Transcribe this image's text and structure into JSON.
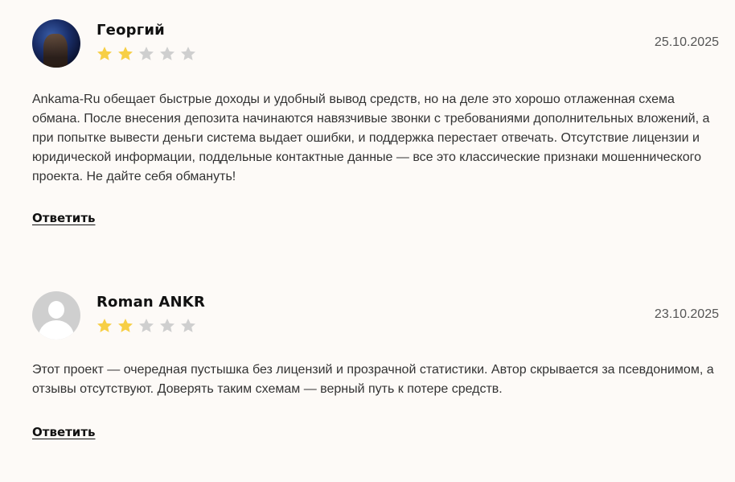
{
  "colors": {
    "star_filled": "#f7cf45",
    "star_empty": "#cfcfcf",
    "background": "#fdfaf7"
  },
  "reviews": [
    {
      "author": "Георгий",
      "date": "25.10.2025",
      "rating": 2,
      "max_rating": 5,
      "avatar": "user-photo",
      "text": "Ankama-Ru обещает быстрые доходы и удобный вывод средств, но на деле это хорошо отлаженная схема обмана. После внесения депозита начинаются навязчивые звонки с требованиями дополнительных вложений, а при попытке вывести деньги система выдает ошибки, и поддержка перестает отвечать. Отсутствие лицензии и юридической информации, поддельные контактные данные — все это классические признаки мошеннического проекта. Не дайте себя обмануть!",
      "reply_label": "Ответить"
    },
    {
      "author": "Roman ANKR",
      "date": "23.10.2025",
      "rating": 2,
      "max_rating": 5,
      "avatar": "default-user-icon",
      "text": "Этот проект — очередная пустышка без лицензий и прозрачной статистики. Автор скрывается за псевдонимом, а отзывы отсутствуют. Доверять таким схемам — верный путь к потере средств.",
      "reply_label": "Ответить"
    }
  ]
}
